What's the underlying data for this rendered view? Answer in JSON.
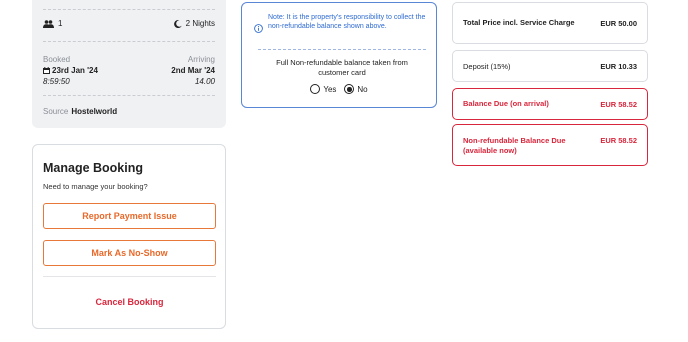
{
  "summary": {
    "guests": "1",
    "nights": "2 Nights",
    "booked_label": "Booked",
    "booked_date": "23rd Jan '24",
    "booked_time": "8:59:50",
    "arriving_label": "Arriving",
    "arriving_date": "2nd Mar '24",
    "arriving_time": "14.00",
    "source_label": "Source",
    "source_value": "Hostelworld"
  },
  "manage": {
    "title": "Manage Booking",
    "subtitle": "Need to manage your booking?",
    "report_label": "Report Payment Issue",
    "noshow_label": "Mark As No-Show",
    "cancel_label": "Cancel Booking"
  },
  "note": {
    "text": "Note: It is the property's responsibility to collect the non-refundable balance shown above.",
    "question": "Full Non-refundable balance taken from customer card",
    "options": [
      {
        "label": "Yes",
        "selected": false
      },
      {
        "label": "No",
        "selected": true
      }
    ]
  },
  "prices": [
    {
      "label": "Total Price incl. Service Charge",
      "value": "EUR 50.00",
      "highlight": false
    },
    {
      "label": "Deposit (15%)",
      "value": "EUR 10.33",
      "highlight": false
    },
    {
      "label": "Balance Due (on arrival)",
      "value": "EUR 58.52",
      "highlight": true
    },
    {
      "label": "Non-refundable Balance Due (available now)",
      "value": "EUR 58.52",
      "highlight": true
    }
  ],
  "colors": {
    "accent_orange": "#e8692a",
    "alert_red": "#d8263c",
    "note_blue": "#2f6bd1"
  }
}
